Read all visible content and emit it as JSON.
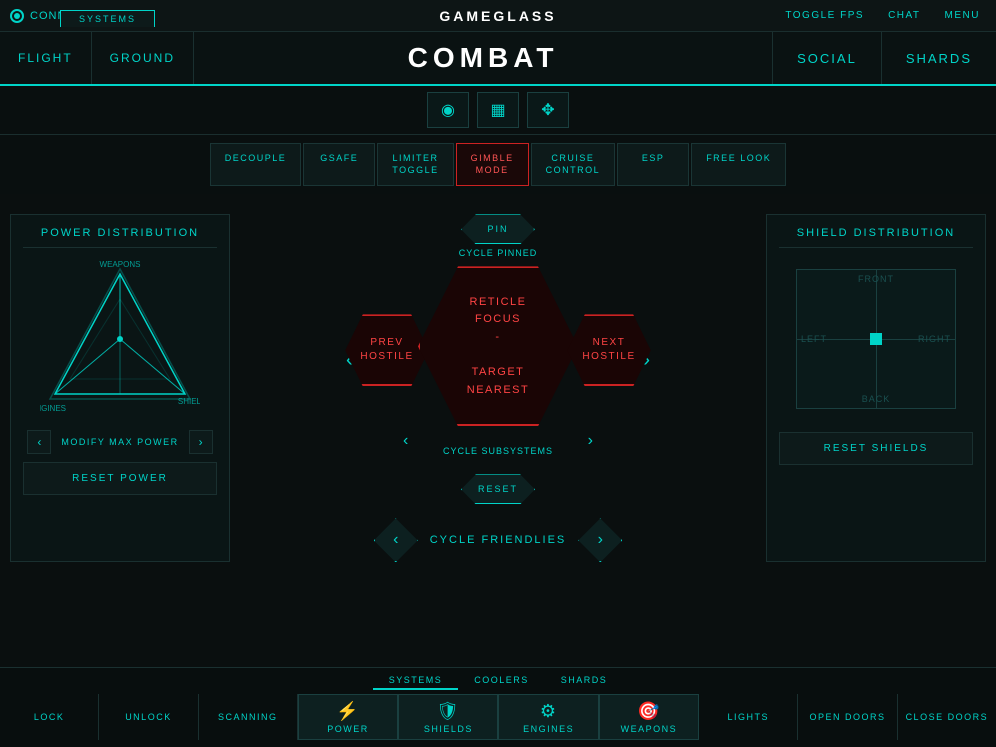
{
  "topbar": {
    "connected": "CONNECTED",
    "title_game": "GAME",
    "title_glass": "GLASS",
    "toggle_fps": "TOGGLE FPS",
    "chat": "CHAT",
    "menu": "MENU"
  },
  "nav": {
    "systems": "SYSTEMS",
    "flight": "FLIGHT",
    "ground": "GROUND",
    "combat": "COMBAT",
    "social": "SOCIAL",
    "shards": "SHARDS"
  },
  "icons": {
    "wifi": "⊛",
    "grid": "⊞",
    "shield_icon": "⛉"
  },
  "toggles": [
    {
      "label": "DECOUPLE",
      "active": false
    },
    {
      "label": "GSAFE",
      "active": false
    },
    {
      "label": "LIMITER\nTOGGLE",
      "active": false
    },
    {
      "label": "GIMBLE\nMODE",
      "active": true
    },
    {
      "label": "CRUISE\nCONTROL",
      "active": false
    },
    {
      "label": "ESP",
      "active": false
    },
    {
      "label": "FREE LOOK",
      "active": false
    }
  ],
  "power": {
    "title": "POWER DISTRIBUTION",
    "labels": {
      "weapons": "WEAPONS",
      "shields": "SHIELDS",
      "engines": "ENGINES"
    },
    "modify_label": "MODIFY MAX POWER",
    "reset_label": "RESET POWER"
  },
  "combat_hex": {
    "pin": "PIN",
    "cycle_pinned": "CYCLE PINNED",
    "reticle_focus": "RETICLE\nFOCUS",
    "dash": "-",
    "target_nearest": "TARGET\nNEAREST",
    "prev_hostile": "PREV\nHOSTILE",
    "next_hostile": "NEXT\nHOSTILE",
    "cycle_subsystems": "CYCLE SUBSYSTEMS",
    "reset": "RESET"
  },
  "cycle_friendlies": {
    "label": "CYCLE FRIENDLIES"
  },
  "shield": {
    "title": "SHIELD DISTRIBUTION",
    "front": "FRONT",
    "back": "BACK",
    "left": "LEFT",
    "right": "RIGHT",
    "reset_label": "RESET SHIELDS"
  },
  "bottom": {
    "tabs": [
      "SYSTEMS",
      "COOLERS",
      "SHARDS"
    ],
    "active_tab": "SYSTEMS",
    "actions": [
      {
        "label": "LOCK",
        "icon": false
      },
      {
        "label": "UNLOCK",
        "icon": false
      },
      {
        "label": "SCANNING",
        "icon": false
      },
      {
        "label": "POWER",
        "icon": true,
        "icon_char": "⚡"
      },
      {
        "label": "SHIELDS",
        "icon": true,
        "icon_char": "🛡"
      },
      {
        "label": "ENGINES",
        "icon": true,
        "icon_char": "⚙"
      },
      {
        "label": "WEAPONS",
        "icon": true,
        "icon_char": "🎯"
      },
      {
        "label": "LIGHTS",
        "icon": false
      },
      {
        "label": "OPEN DOORS",
        "icon": false
      },
      {
        "label": "CLOSE DOORS",
        "icon": false
      }
    ]
  }
}
